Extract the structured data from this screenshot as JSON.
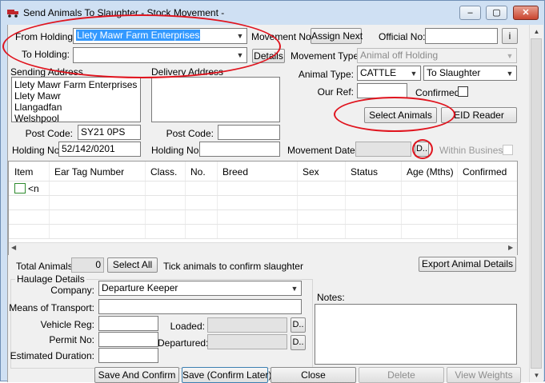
{
  "window": {
    "title": "Send Animals To Slaughter - Stock Movement -",
    "minimize": "–",
    "maximize": "▢",
    "close": "✕"
  },
  "holding": {
    "from_label": "From Holding:",
    "from_value": "Llety Mawr Farm Enterprises",
    "to_label": "To Holding:",
    "to_value": "",
    "details_label": "Details"
  },
  "movement": {
    "no_label": "Movement No:",
    "assign_next": "Assign Next",
    "official_label": "Official No:",
    "official_value": "",
    "official_btn": "i",
    "type_label": "Movement Type:",
    "type_value": "Animal off Holding",
    "animal_type_label": "Animal Type:",
    "animal_type_value": "CATTLE",
    "destination_value": "To Slaughter",
    "our_ref_label": "Our Ref:",
    "our_ref_value": "",
    "confirmed_label": "Confirmed:",
    "select_animals": "Select Animals",
    "eid_reader": "EID Reader",
    "date_label": "Movement Date:",
    "date_value": "",
    "date_btn": "D..",
    "within_business_label": "Within Business"
  },
  "sending": {
    "label": "Sending Address",
    "lines": [
      "Llety Mawr Farm Enterprises",
      "Llety Mawr",
      "Llangadfan",
      "Welshpool"
    ],
    "postcode_label": "Post Code:",
    "postcode_value": "SY21 0PS",
    "holding_label": "Holding No:",
    "holding_value": "52/142/0201"
  },
  "delivery": {
    "label": "Delivery Address",
    "postcode_label": "Post Code:",
    "postcode_value": "",
    "holding_label": "Holding No:",
    "holding_value": ""
  },
  "grid": {
    "columns": [
      "Item",
      "Ear Tag Number",
      "Class.",
      "No.",
      "Breed",
      "Sex",
      "Status",
      "Age (Mths)",
      "Confirmed"
    ],
    "new_row_label": "<n"
  },
  "totals": {
    "label": "Total Animals:",
    "value": "0",
    "select_all": "Select All",
    "hint": "Tick animals to confirm slaughter",
    "export": "Export Animal Details"
  },
  "haulage": {
    "title": "Haulage Details",
    "company_label": "Company:",
    "company_value": "Departure Keeper",
    "transport_label": "Means of Transport:",
    "transport_value": "",
    "vehicle_label": "Vehicle Reg:",
    "vehicle_value": "",
    "permit_label": "Permit No:",
    "permit_value": "",
    "duration_label": "Estimated Duration:",
    "duration_value": "",
    "loaded_label": "Loaded:",
    "loaded_btn": "D..",
    "departured_label": "Departured:",
    "departured_btn": "D.."
  },
  "notes": {
    "label": "Notes:"
  },
  "footer": {
    "save_confirm": "Save And Confirm",
    "save_later": "Save (Confirm Later)",
    "close": "Close",
    "delete": "Delete",
    "view_weights": "View Weights"
  },
  "colors": {
    "annotation_red": "#e0141e",
    "selection_blue": "#3399ff",
    "frame_blue": "#cfe0f3"
  }
}
